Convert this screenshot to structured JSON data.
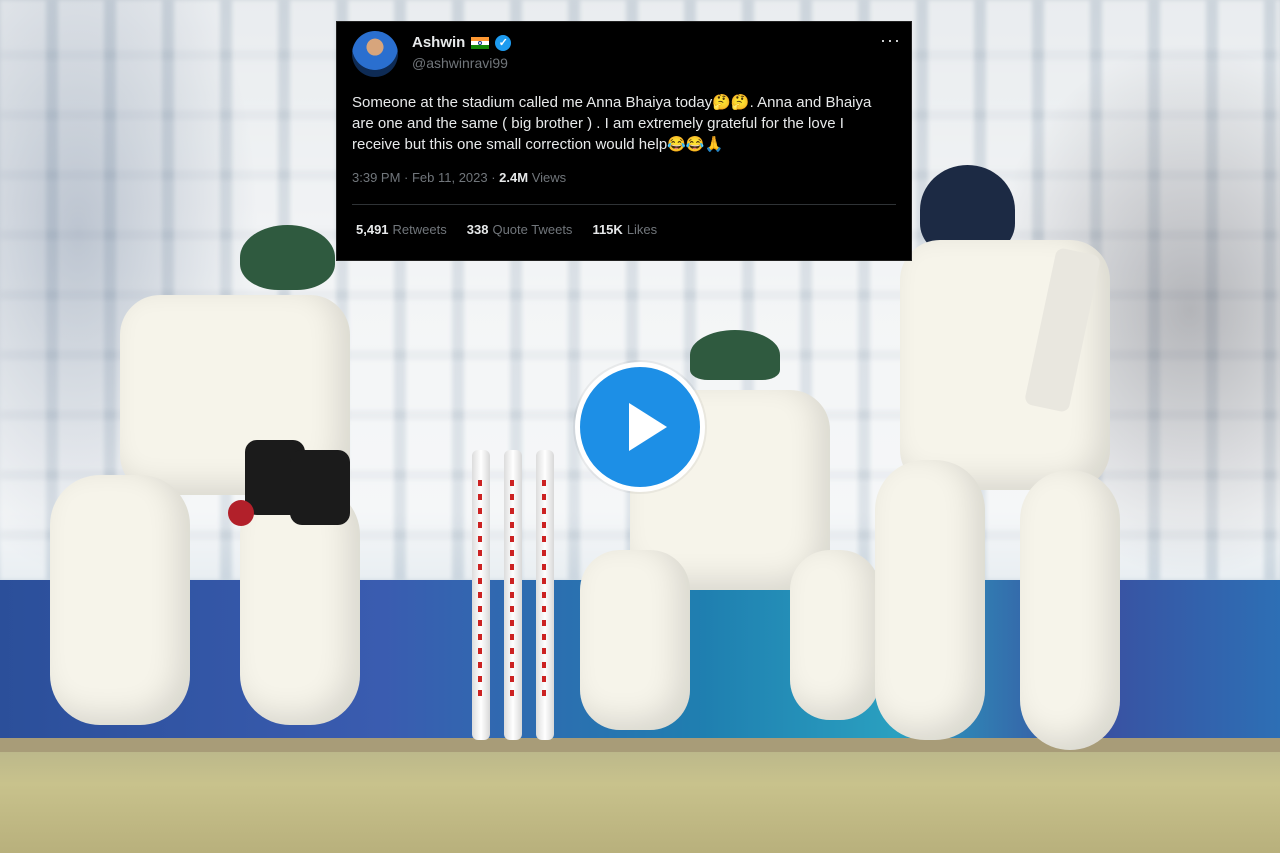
{
  "tweet": {
    "name": "Ashwin",
    "handle": "@ashwinravi99",
    "more_icon": "more-options-icon",
    "text": "Someone at the stadium called me Anna Bhaiya today🤔🤔. Anna and Bhaiya are one and the same ( big brother ) . I am extremely grateful for the love I receive but this one small correction would help😂😂🙏",
    "time": "3:39 PM · Feb 11, 2023 · ",
    "views_count": "2.4M",
    "views_label": " Views",
    "retweets_count": "5,491",
    "retweets_label": "Retweets",
    "quote_count": "338",
    "quote_label": "Quote Tweets",
    "likes_count": "115K",
    "likes_label": "Likes"
  },
  "player": {
    "play_icon": "play-icon"
  },
  "colors": {
    "tweet_bg": "#000000",
    "play_blue": "#1d8fe6",
    "verified_blue": "#1d9bf0"
  }
}
